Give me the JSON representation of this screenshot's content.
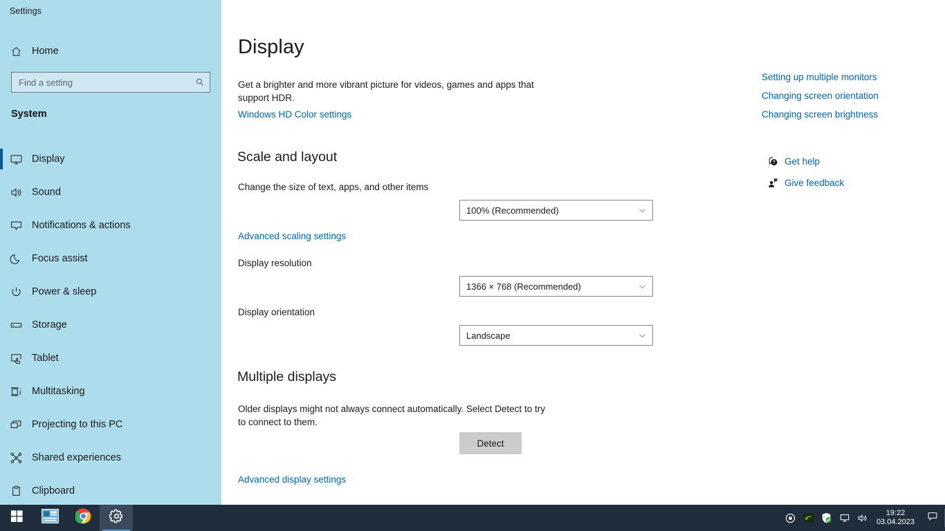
{
  "window": {
    "title": "Settings",
    "controls": {
      "minimize": "minimize-icon",
      "maximize": "restore-icon",
      "close": "close-icon"
    }
  },
  "sidebar": {
    "home_label": "Home",
    "home_icon": "home-icon",
    "search": {
      "placeholder": "Find a setting",
      "value": "",
      "icon": "search-icon"
    },
    "category": "System",
    "selected_index": 0,
    "accent_color": "#005a9e",
    "background_color": "#addced",
    "items": [
      {
        "label": "Display",
        "icon": "monitor-icon"
      },
      {
        "label": "Sound",
        "icon": "speaker-icon"
      },
      {
        "label": "Notifications & actions",
        "icon": "notification-icon"
      },
      {
        "label": "Focus assist",
        "icon": "moon-icon"
      },
      {
        "label": "Power & sleep",
        "icon": "power-icon"
      },
      {
        "label": "Storage",
        "icon": "drive-icon"
      },
      {
        "label": "Tablet",
        "icon": "tablet-icon"
      },
      {
        "label": "Multitasking",
        "icon": "multitasking-icon"
      },
      {
        "label": "Projecting to this PC",
        "icon": "projecting-icon"
      },
      {
        "label": "Shared experiences",
        "icon": "share-icon"
      },
      {
        "label": "Clipboard",
        "icon": "clipboard-icon"
      }
    ]
  },
  "main": {
    "title": "Display",
    "hdr": {
      "description": "Get a brighter and more vibrant picture for videos, games and apps that support HDR.",
      "link": "Windows HD Color settings"
    },
    "scale_section": {
      "heading": "Scale and layout",
      "scale_label": "Change the size of text, apps, and other items",
      "scale_value": "100% (Recommended)",
      "advanced_link": "Advanced scaling settings",
      "resolution_label": "Display resolution",
      "resolution_value": "1366 × 768 (Recommended)",
      "orientation_label": "Display orientation",
      "orientation_value": "Landscape"
    },
    "multiple_displays": {
      "heading": "Multiple displays",
      "description": "Older displays might not always connect automatically. Select Detect to try to connect to them.",
      "detect_button": "Detect",
      "advanced_link": "Advanced display settings"
    }
  },
  "rail": {
    "links": [
      "Setting up multiple monitors",
      "Changing screen orientation",
      "Changing screen brightness"
    ],
    "actions": [
      {
        "label": "Get help",
        "icon": "help-bubble-icon"
      },
      {
        "label": "Give feedback",
        "icon": "feedback-person-icon"
      }
    ],
    "link_color": "#0066aa"
  },
  "taskbar": {
    "background_color": "#1f2d3d",
    "apps": [
      {
        "name": "start-button",
        "icon": "windows-logo-icon",
        "active": false
      },
      {
        "name": "task-view-button",
        "icon": "blue-app-icon",
        "active": false
      },
      {
        "name": "chrome-button",
        "icon": "chrome-icon",
        "active": false
      },
      {
        "name": "settings-button",
        "icon": "gear-icon",
        "active": true
      }
    ],
    "tray": [
      {
        "name": "recorder-tray-icon",
        "icon": "record-circle-icon"
      },
      {
        "name": "nvidia-tray-icon",
        "icon": "nvidia-eye-icon"
      },
      {
        "name": "defender-tray-icon",
        "icon": "shield-check-icon"
      },
      {
        "name": "network-tray-icon",
        "icon": "network-icon"
      },
      {
        "name": "volume-tray-icon",
        "icon": "volume-icon"
      }
    ],
    "clock": {
      "time": "19:22",
      "date": "03.04.2023"
    },
    "notification_icon": "notification-center-icon"
  }
}
